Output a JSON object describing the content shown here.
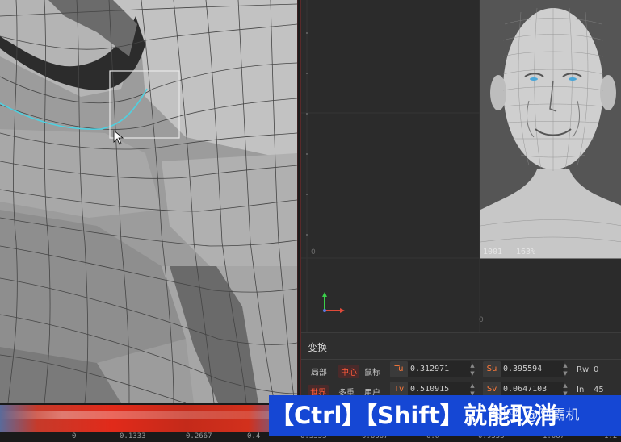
{
  "viewport_uv": {
    "origin_label": "0",
    "tick_lower": "0"
  },
  "head_thumbnail": {
    "tile_label": "1001",
    "zoom_label": "163%"
  },
  "transform_panel": {
    "title": "变换",
    "row1": {
      "local_label": "局部",
      "center_label": "中心",
      "mouse_label": "鼠标",
      "tu_label": "Tu",
      "tu_value": "0.312971",
      "su_label": "Su",
      "su_value": "0.395594",
      "rw_label": "Rw",
      "rw_value": "0"
    },
    "row2": {
      "world_label": "世界",
      "multi_label": "多重",
      "user_label": "用户",
      "tv_label": "Tv",
      "tv_value": "0.510915",
      "sv_label": "Sv",
      "sv_value": "0.0647103",
      "in_label": "In",
      "in_value": "45"
    }
  },
  "timeline": {
    "scale": [
      "0",
      "0.1333",
      "0.2667",
      "0.4",
      "0.5333",
      "0.6667",
      "0.8",
      "0.9333",
      "1.067",
      "1.2"
    ]
  },
  "overlay": {
    "subtitle": "【Ctrl】【Shift】就能取消",
    "watermark": "知乎 @阿霸机"
  },
  "colors": {
    "accent": "#ff5a3a",
    "subtitle_bg": "#1547d4",
    "selection": "#4fd0e0"
  }
}
